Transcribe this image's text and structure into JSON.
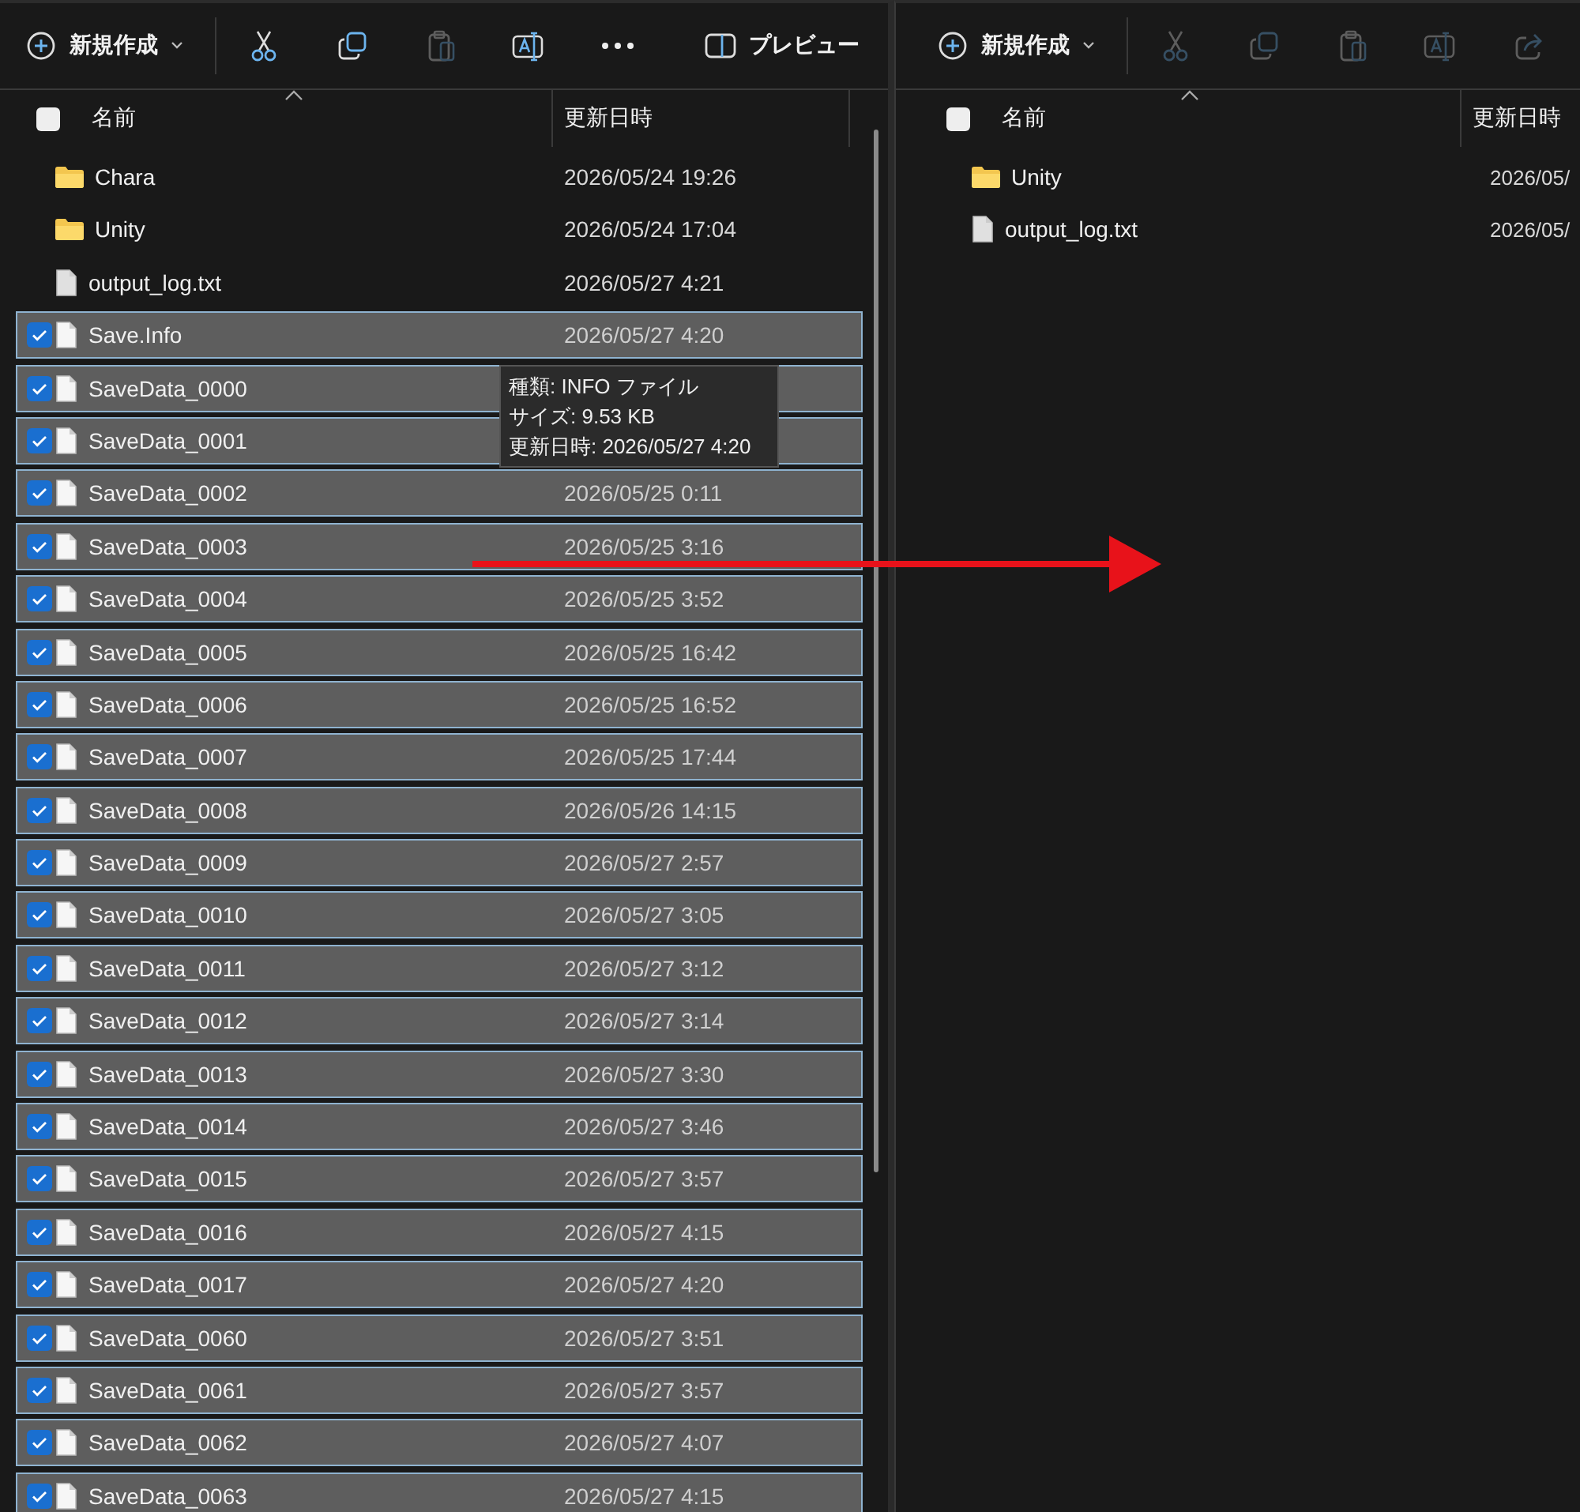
{
  "panes": [
    {
      "toolbar": {
        "new_label": "新規作成",
        "buttons": [
          {
            "kind": "cut",
            "disabled": false
          },
          {
            "kind": "copy",
            "disabled": false
          },
          {
            "kind": "paste",
            "disabled": true
          },
          {
            "kind": "rename",
            "disabled": false
          },
          {
            "kind": "more",
            "disabled": false
          }
        ],
        "preview_label": "プレビュー"
      },
      "columns": [
        "名前",
        "更新日時"
      ],
      "select_all_checked": false,
      "rows": [
        {
          "kind": "folder",
          "name": "Chara",
          "date": "2026/05/24 19:26",
          "selected": false
        },
        {
          "kind": "folder",
          "name": "Unity",
          "date": "2026/05/24 17:04",
          "selected": false
        },
        {
          "kind": "file",
          "name": "output_log.txt",
          "date": "2026/05/27 4:21",
          "selected": false
        },
        {
          "kind": "file",
          "name": "Save.Info",
          "date": "2026/05/27 4:20",
          "selected": true
        },
        {
          "kind": "file",
          "name": "SaveData_0000",
          "selected": true
        },
        {
          "kind": "file",
          "name": "SaveData_0001",
          "selected": true
        },
        {
          "kind": "file",
          "name": "SaveData_0002",
          "date": "2026/05/25 0:11",
          "selected": true
        },
        {
          "kind": "file",
          "name": "SaveData_0003",
          "date": "2026/05/25 3:16",
          "selected": true
        },
        {
          "kind": "file",
          "name": "SaveData_0004",
          "date": "2026/05/25 3:52",
          "selected": true
        },
        {
          "kind": "file",
          "name": "SaveData_0005",
          "date": "2026/05/25 16:42",
          "selected": true
        },
        {
          "kind": "file",
          "name": "SaveData_0006",
          "date": "2026/05/25 16:52",
          "selected": true
        },
        {
          "kind": "file",
          "name": "SaveData_0007",
          "date": "2026/05/25 17:44",
          "selected": true
        },
        {
          "kind": "file",
          "name": "SaveData_0008",
          "date": "2026/05/26 14:15",
          "selected": true
        },
        {
          "kind": "file",
          "name": "SaveData_0009",
          "date": "2026/05/27 2:57",
          "selected": true
        },
        {
          "kind": "file",
          "name": "SaveData_0010",
          "date": "2026/05/27 3:05",
          "selected": true
        },
        {
          "kind": "file",
          "name": "SaveData_0011",
          "date": "2026/05/27 3:12",
          "selected": true
        },
        {
          "kind": "file",
          "name": "SaveData_0012",
          "date": "2026/05/27 3:14",
          "selected": true
        },
        {
          "kind": "file",
          "name": "SaveData_0013",
          "date": "2026/05/27 3:30",
          "selected": true
        },
        {
          "kind": "file",
          "name": "SaveData_0014",
          "date": "2026/05/27 3:46",
          "selected": true
        },
        {
          "kind": "file",
          "name": "SaveData_0015",
          "date": "2026/05/27 3:57",
          "selected": true
        },
        {
          "kind": "file",
          "name": "SaveData_0016",
          "date": "2026/05/27 4:15",
          "selected": true
        },
        {
          "kind": "file",
          "name": "SaveData_0017",
          "date": "2026/05/27 4:20",
          "selected": true
        },
        {
          "kind": "file",
          "name": "SaveData_0060",
          "date": "2026/05/27 3:51",
          "selected": true
        },
        {
          "kind": "file",
          "name": "SaveData_0061",
          "date": "2026/05/27 3:57",
          "selected": true
        },
        {
          "kind": "file",
          "name": "SaveData_0062",
          "date": "2026/05/27 4:07",
          "selected": true
        },
        {
          "kind": "file",
          "name": "SaveData_0063",
          "date": "2026/05/27 4:15",
          "selected": true
        }
      ],
      "tooltip": {
        "lines": [
          "種類: INFO ファイル",
          "サイズ: 9.53 KB",
          "更新日時: 2026/05/27 4:20"
        ]
      }
    },
    {
      "toolbar": {
        "new_label": "新規作成",
        "buttons": [
          {
            "kind": "cut",
            "disabled": true
          },
          {
            "kind": "copy",
            "disabled": true
          },
          {
            "kind": "paste",
            "disabled": true
          },
          {
            "kind": "rename",
            "disabled": true
          },
          {
            "kind": "share",
            "disabled": true
          }
        ]
      },
      "columns": [
        "名前",
        "更新日時"
      ],
      "select_all_checked": false,
      "rows": [
        {
          "kind": "folder",
          "name": "Unity",
          "date": "2026/05/",
          "selected": false
        },
        {
          "kind": "file",
          "name": "output_log.txt",
          "date": "2026/05/",
          "selected": false
        }
      ]
    }
  ]
}
